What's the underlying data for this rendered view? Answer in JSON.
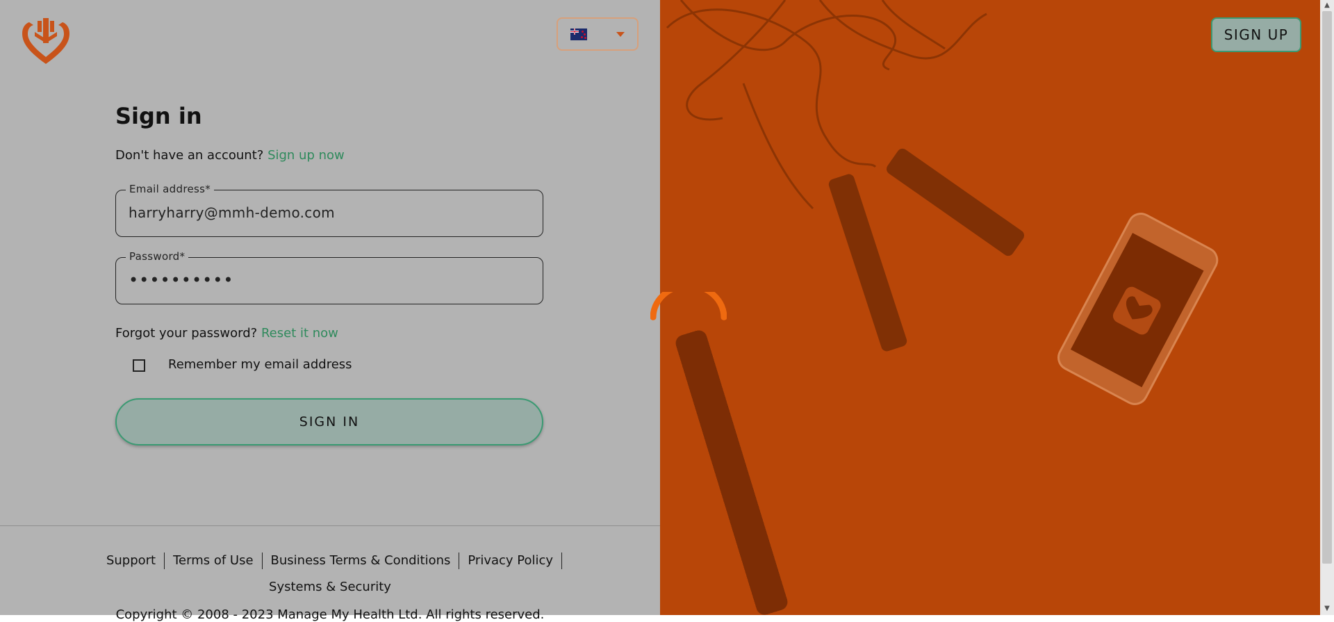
{
  "header": {
    "logo_icon": "heart-tree-logo-icon",
    "language": {
      "flag_icon": "nz-flag-icon",
      "dropdown_icon": "caret-down-icon"
    },
    "signup_label": "SIGN UP"
  },
  "form": {
    "title": "Sign in",
    "no_account_text": "Don't have an account?",
    "signup_link": "Sign up now",
    "email": {
      "label": "Email address*",
      "value": "harryharry@mmh-demo.com"
    },
    "password": {
      "label": "Password*",
      "masked_value": "••••••••••"
    },
    "forgot_text": "Forgot your password?",
    "reset_link": "Reset it now",
    "remember_label": "Remember my email address",
    "remember_checked": false,
    "signin_label": "SIGN IN"
  },
  "footer": {
    "links": [
      "Support",
      "Terms of Use",
      "Business Terms & Conditions",
      "Privacy Policy",
      "Systems & Security"
    ],
    "copyright": "Copyright © 2008 - 2023 Manage My Health Ltd. All rights reserved."
  },
  "colors": {
    "brand_orange": "#c8531a",
    "link_green": "#2f8a5c",
    "button_fill": "#96aca5",
    "hero_overlay": "#b84608"
  }
}
